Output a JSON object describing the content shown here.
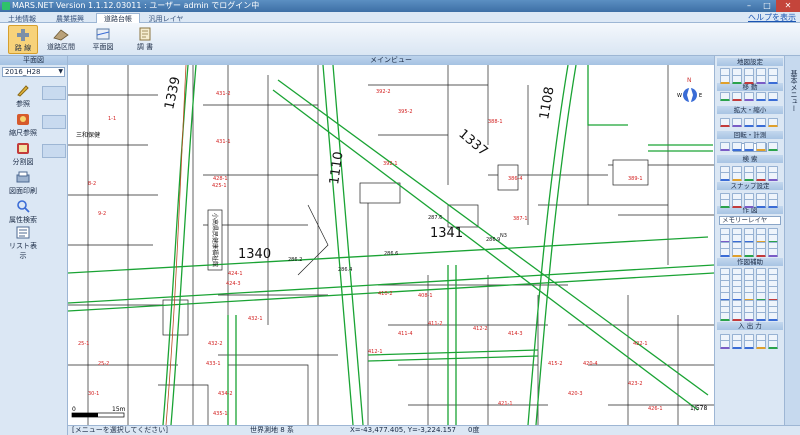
{
  "window": {
    "title": "MARS.NET Version 1.1.12.03011 : ユーザー admin でログイン中"
  },
  "tabs": [
    {
      "label": "土地情報",
      "active": false
    },
    {
      "label": "農業振興",
      "active": false
    },
    {
      "label": "道路台帳",
      "active": true
    },
    {
      "label": "汎用レイヤ",
      "active": false
    }
  ],
  "help_link": "ヘルプを表示",
  "ribbon": {
    "buttons": [
      {
        "label": "路 線",
        "icon": "plus-icon",
        "selected": true
      },
      {
        "label": "道路区間",
        "icon": "road-icon",
        "selected": false
      },
      {
        "label": "平面図",
        "icon": "plan-icon",
        "selected": false
      },
      {
        "label": "調 書",
        "icon": "document-icon",
        "selected": false
      }
    ]
  },
  "left_panel": {
    "header": "平面図",
    "year_select": "2016_H28",
    "buttons": [
      {
        "label": "参照",
        "icon": "pencil-icon"
      },
      {
        "label": "縮尺参照",
        "icon": "scale-icon"
      },
      {
        "label": "分割図",
        "icon": "split-map-icon"
      },
      {
        "label": "図面印刷",
        "icon": "print-icon"
      },
      {
        "label": "属性検索",
        "icon": "search-icon"
      },
      {
        "label": "リスト表示",
        "icon": "list-icon"
      }
    ]
  },
  "map": {
    "header": "メインビュー",
    "scale_bar": {
      "left": "0",
      "right": "15m"
    },
    "scale_ratio": "1/578",
    "labels": {
      "route_numbers": [
        "1339",
        "1337",
        "1108",
        "1110",
        "1340",
        "1341"
      ],
      "facility_names": [
        "三和保健",
        "小高県民健康福祉館"
      ],
      "node_ids": [
        "286.4",
        "286.2",
        "286.6",
        "287.6",
        "286.9",
        "N3"
      ],
      "parcel_ids": [
        "431-2",
        "431-1",
        "425-1",
        "392-2",
        "395-2",
        "392-1",
        "388-1",
        "386-4",
        "387-1",
        "389-1",
        "410-2",
        "408-1",
        "411-2",
        "411-4",
        "412-1",
        "412-2",
        "414-3",
        "415-2",
        "420-4",
        "420-3",
        "421-1",
        "422-1",
        "423-2",
        "426-1",
        "428-1",
        "424-1",
        "424-3",
        "432-1",
        "432-2",
        "433-1",
        "434-2",
        "435-1",
        "8-2",
        "9-2",
        "1-1",
        "25-1",
        "25-2",
        "30-1"
      ]
    }
  },
  "status_bar": {
    "message": "[メニューを選択してください]",
    "coordinate_system": "世界測地 8 系",
    "coordinates": "X=-43,477.405,  Y=-3,224.157",
    "angle": "0度"
  },
  "right_panel": {
    "sections": [
      {
        "title": "地図設定"
      },
      {
        "title": "移 動"
      },
      {
        "title": "拡大・縮小"
      },
      {
        "title": "回転・計測"
      },
      {
        "title": "検 索"
      },
      {
        "title": "スナップ設定"
      },
      {
        "title": "作 図"
      },
      {
        "title": "作図補助"
      },
      {
        "title": "入 出 力"
      }
    ],
    "rotation_value": "0",
    "layer_select": "メモリーレイヤ"
  },
  "vertical_tab": "基本メニュー",
  "colors": {
    "road_line": "#1aa334",
    "parcel_text": "#d21e1e",
    "accent": "#3a6cd6"
  }
}
